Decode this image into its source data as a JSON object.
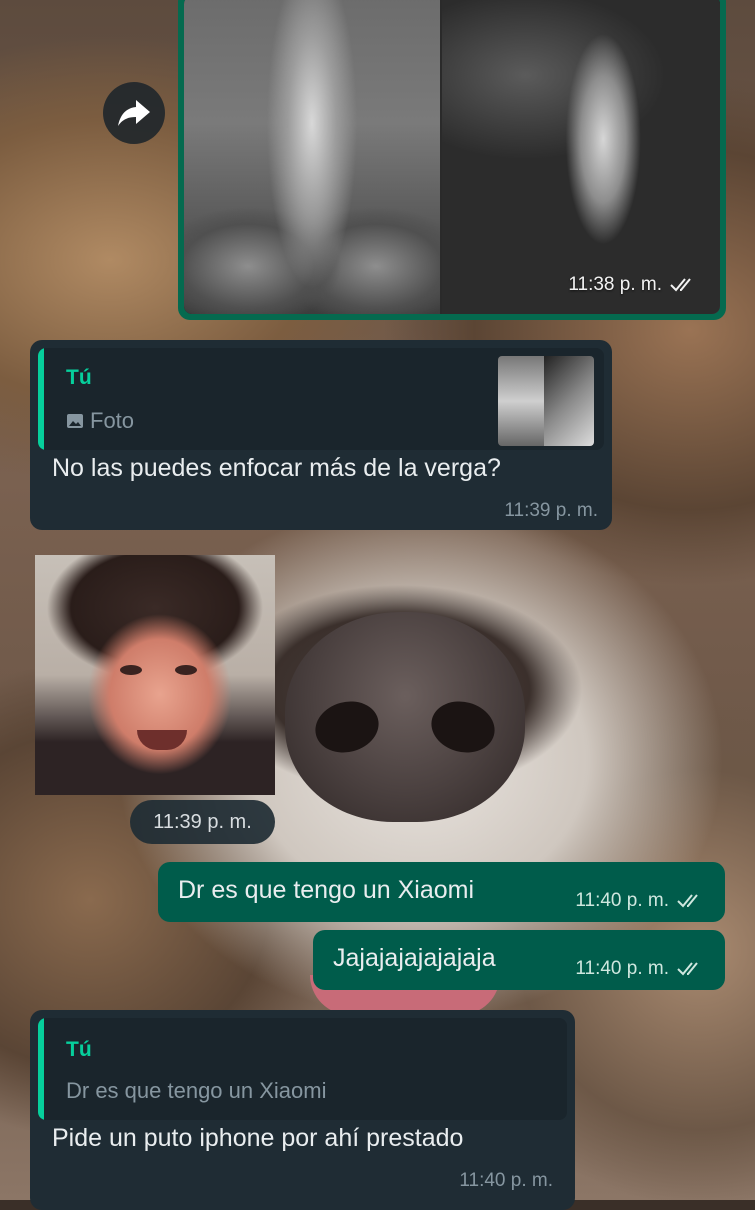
{
  "forward": {
    "icon": "share-forward-icon"
  },
  "xray_message": {
    "time": "11:38 p. m.",
    "status_icon": "double-check-icon"
  },
  "reply1": {
    "quote_author": "Tú",
    "quote_type_label": "Foto",
    "text": "No las puedes enfocar más de la verga?",
    "time": "11:39 p. m."
  },
  "sticker_message": {
    "time": "11:39 p. m."
  },
  "out1": {
    "text": "Dr es que tengo un Xiaomi",
    "time": "11:40 p. m."
  },
  "out2": {
    "text": "Jajajajajajajaja",
    "time": "11:40 p. m."
  },
  "reply2": {
    "quote_author": "Tú",
    "quote_text": "Dr es que tengo un Xiaomi",
    "text": "Pide un puto iphone por ahí prestado",
    "time": "11:40 p. m."
  },
  "colors": {
    "incoming": "#1f2c34",
    "outgoing": "#005c4b",
    "accent": "#06cf9c"
  }
}
